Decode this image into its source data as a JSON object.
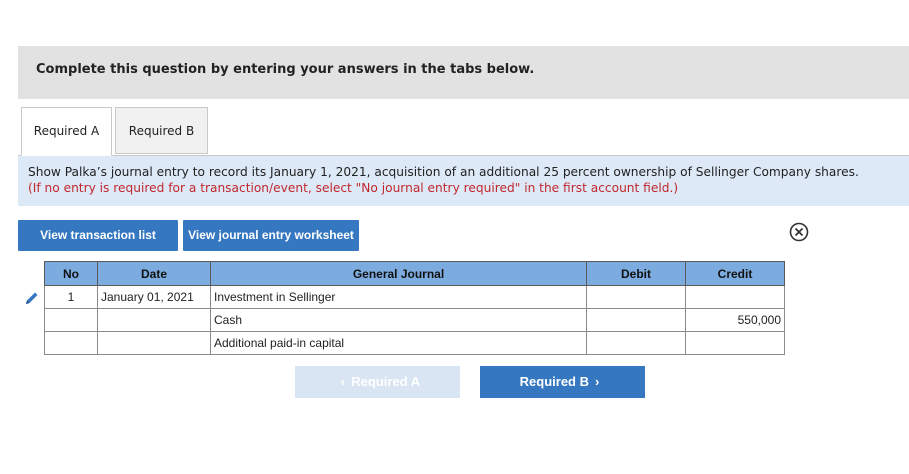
{
  "banner": {
    "text": "Complete this question by entering your answers in the tabs below."
  },
  "tabs": [
    {
      "label": "Required A",
      "active": true
    },
    {
      "label": "Required B",
      "active": false
    }
  ],
  "instructions": {
    "main": "Show Palka’s journal entry to record its January 1, 2021, acquisition of an additional 25 percent ownership of Sellinger Company shares.",
    "note": "(If no entry is required for a transaction/event, select \"No journal entry required\" in the first account field.)"
  },
  "toolbar": {
    "view_transaction_list": "View transaction list",
    "view_journal_worksheet": "View journal entry worksheet"
  },
  "journal": {
    "headers": {
      "no": "No",
      "date": "Date",
      "account": "General Journal",
      "debit": "Debit",
      "credit": "Credit"
    },
    "rows": [
      {
        "no": "1",
        "date": "January 01, 2021",
        "account": "Investment in Sellinger",
        "debit": "",
        "credit": ""
      },
      {
        "no": "",
        "date": "",
        "account": "Cash",
        "debit": "",
        "credit": "550,000"
      },
      {
        "no": "",
        "date": "",
        "account": "Additional paid-in capital",
        "debit": "",
        "credit": ""
      }
    ]
  },
  "navigation": {
    "prev_label": "Required A",
    "next_label": "Required B",
    "prev_chevron": "‹",
    "next_chevron": "›"
  },
  "colors": {
    "accent": "#3577c1",
    "header_bg": "#7cacdf",
    "instruction_bg": "#dde9f7",
    "note_red": "#c0282d"
  },
  "icons": {
    "close": "close-circle-icon",
    "edit": "pencil-icon"
  }
}
